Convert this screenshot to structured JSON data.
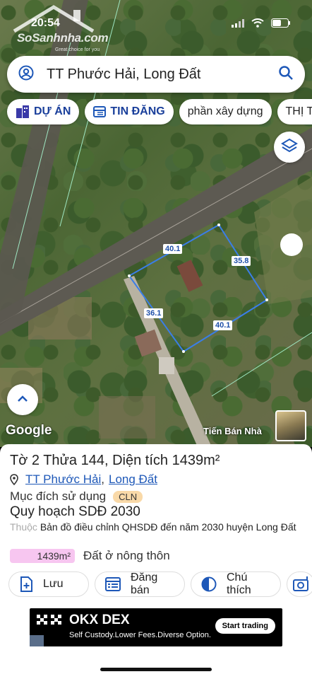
{
  "status": {
    "time": "20:54"
  },
  "watermark": {
    "brand": "SoSanhnha.com",
    "tagline": "Great choice for you"
  },
  "search": {
    "query": "TT Phước Hải, Long Đất"
  },
  "chips": [
    {
      "label": "DỰ ÁN"
    },
    {
      "label": "TIN ĐĂNG"
    },
    {
      "label": "phần xây dựng"
    },
    {
      "label": "THỊ TRƯ"
    }
  ],
  "map": {
    "dims": [
      "40.1",
      "35.8",
      "36.1",
      "40.1"
    ],
    "google_label": "Google",
    "credit": "Tiến Bán Nhà",
    "parcel_color": "#3a7ee8"
  },
  "parcel": {
    "title": "Tờ 2 Thửa 144, Diện tích 1439m²",
    "location": {
      "town": "TT Phước Hải",
      "district": "Long Đất"
    },
    "purpose_label": "Mục đích sử dụng",
    "purpose_code": "CLN",
    "plan_title": "Quy hoạch SDĐ 2030",
    "note_prefix": "Thuộc",
    "note": "Bản đồ điều chỉnh QHSDĐ đến năm 2030 huyện Long Đất",
    "area_value": "1439m²",
    "area_label": "Đất ở nông thôn"
  },
  "actions": [
    {
      "label": "Lưu"
    },
    {
      "label": "Đăng bán"
    },
    {
      "label": "Chú thích"
    }
  ],
  "ad": {
    "name": "OKX DEX",
    "subtitle": "Self Custody.Lower Fees.Diverse Option.",
    "cta": "Start trading"
  }
}
